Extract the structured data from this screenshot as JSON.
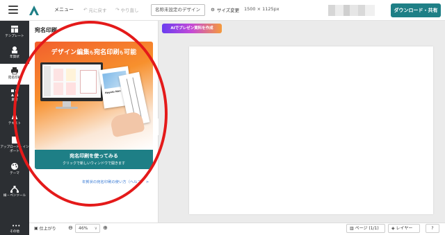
{
  "topbar": {
    "menu_label": "メニュー",
    "undo_label": "元に戻す",
    "redo_label": "やり直し",
    "design_name": "名称未設定のデザイン",
    "size_change_label": "サイズ変更",
    "size_value": "1500 × 1125px",
    "download_label": "ダウンロード・共有"
  },
  "leftnav": {
    "items": [
      {
        "label": "テンプレート",
        "icon": "template-icon"
      },
      {
        "label": "年賀状",
        "icon": "new-year-card-icon"
      },
      {
        "label": "宛名印刷",
        "icon": "printer-icon"
      },
      {
        "label": "素材",
        "icon": "shapes-icon"
      },
      {
        "label": "テキスト",
        "icon": "text-icon"
      },
      {
        "label": "アップロード・インポート",
        "icon": "upload-icon"
      },
      {
        "label": "テーマ",
        "icon": "palette-icon"
      },
      {
        "label": "線・ペンツール",
        "icon": "pen-tool-icon"
      }
    ],
    "other_label": "その他"
  },
  "panel": {
    "title": "宛名印刷",
    "banner_headline_a": "デザイン編集",
    "banner_headline_b": "も",
    "banner_headline_c": "宛名印刷",
    "banner_headline_d": "も",
    "banner_headline_e": "可能",
    "card_name": "Hayato Nao",
    "cta_main": "宛名印刷を使ってみる",
    "cta_sub": "クリックで新しいウィンドウで開きます",
    "howto_link": "年賀状の宛名印刷の使い方（ヘルプ） >"
  },
  "canvas": {
    "ai_button": "AIでプレゼン資料を作成"
  },
  "bottombar": {
    "finish_label": "仕上がり",
    "zoom_value": "46%",
    "pages_label": "ページ (1/1)",
    "layers_label": "レイヤー",
    "help_label": "?"
  },
  "colors": {
    "accent": "#1e7f86",
    "nav_bg": "#2c2f33",
    "annotation_red": "#e41a1a"
  }
}
